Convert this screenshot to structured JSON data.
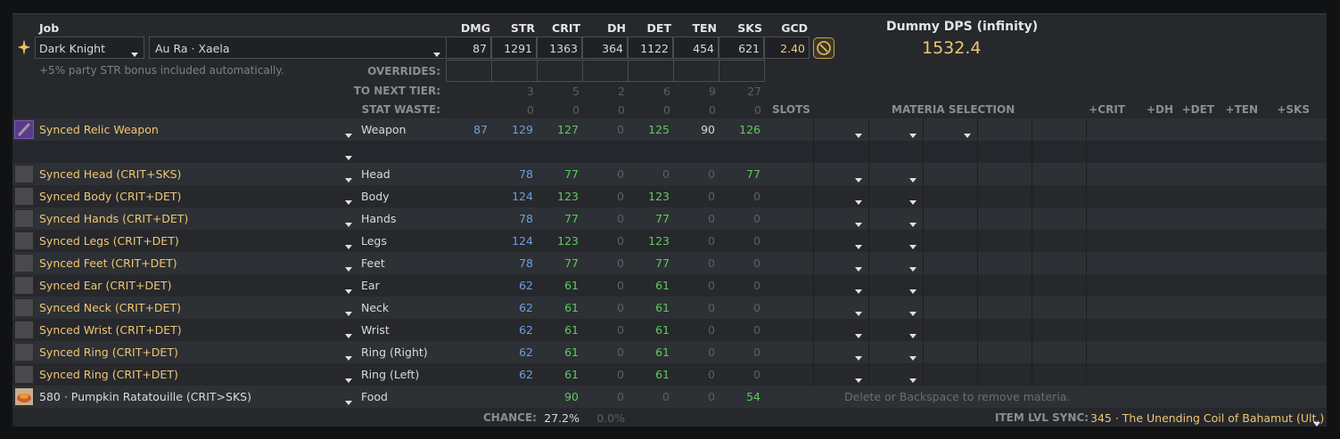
{
  "header": {
    "job_label": "Job",
    "stat_headers": [
      "DMG",
      "STR",
      "CRIT",
      "DH",
      "DET",
      "TEN",
      "SKS",
      "GCD"
    ],
    "job_value": "Dark Knight",
    "race_value": "Au Ra · Xaela",
    "stat_values": [
      "87",
      "1291",
      "1363",
      "364",
      "1122",
      "454",
      "621",
      "2.40"
    ],
    "party_bonus_note": "+5% party STR bonus included automatically.",
    "overrides_label": "OVERRIDES:",
    "to_next_tier_label": "TO NEXT TIER:",
    "to_next_tier_values": [
      "3",
      "5",
      "2",
      "6",
      "9",
      "27"
    ],
    "stat_waste_label": "STAT WASTE:",
    "stat_waste_values": [
      "0",
      "0",
      "0",
      "0",
      "0",
      "0"
    ]
  },
  "dps": {
    "title": "Dummy DPS (infinity)",
    "value": "1532.4"
  },
  "columns": {
    "slots": "SLOTS",
    "materia_selection": "MATERIA SELECTION",
    "plus_headers": [
      "+CRIT",
      "+DH",
      "+DET",
      "+TEN",
      "+SKS"
    ]
  },
  "gear": [
    {
      "name": "Synced Relic Weapon",
      "slot": "Weapon",
      "dmg": "87",
      "str": "129",
      "crit": "127",
      "dh": "0",
      "det": "125",
      "ten": "90",
      "sks": "126",
      "icon": "sword-icon"
    },
    {
      "name": "Synced Head (CRIT+SKS)",
      "slot": "Head",
      "dmg": "",
      "str": "78",
      "crit": "77",
      "dh": "0",
      "det": "0",
      "ten": "0",
      "sks": "77",
      "icon": "head-icon"
    },
    {
      "name": "Synced Body (CRIT+DET)",
      "slot": "Body",
      "dmg": "",
      "str": "124",
      "crit": "123",
      "dh": "0",
      "det": "123",
      "ten": "0",
      "sks": "0",
      "icon": "body-icon"
    },
    {
      "name": "Synced Hands (CRIT+DET)",
      "slot": "Hands",
      "dmg": "",
      "str": "78",
      "crit": "77",
      "dh": "0",
      "det": "77",
      "ten": "0",
      "sks": "0",
      "icon": "hands-icon"
    },
    {
      "name": "Synced Legs (CRIT+DET)",
      "slot": "Legs",
      "dmg": "",
      "str": "124",
      "crit": "123",
      "dh": "0",
      "det": "123",
      "ten": "0",
      "sks": "0",
      "icon": "legs-icon"
    },
    {
      "name": "Synced Feet (CRIT+DET)",
      "slot": "Feet",
      "dmg": "",
      "str": "78",
      "crit": "77",
      "dh": "0",
      "det": "77",
      "ten": "0",
      "sks": "0",
      "icon": "feet-icon"
    },
    {
      "name": "Synced Ear (CRIT+DET)",
      "slot": "Ear",
      "dmg": "",
      "str": "62",
      "crit": "61",
      "dh": "0",
      "det": "61",
      "ten": "0",
      "sks": "0",
      "icon": "ear-icon"
    },
    {
      "name": "Synced Neck (CRIT+DET)",
      "slot": "Neck",
      "dmg": "",
      "str": "62",
      "crit": "61",
      "dh": "0",
      "det": "61",
      "ten": "0",
      "sks": "0",
      "icon": "neck-icon"
    },
    {
      "name": "Synced Wrist (CRIT+DET)",
      "slot": "Wrist",
      "dmg": "",
      "str": "62",
      "crit": "61",
      "dh": "0",
      "det": "61",
      "ten": "0",
      "sks": "0",
      "icon": "wrist-icon"
    },
    {
      "name": "Synced Ring (CRIT+DET)",
      "slot": "Ring (Right)",
      "dmg": "",
      "str": "62",
      "crit": "61",
      "dh": "0",
      "det": "61",
      "ten": "0",
      "sks": "0",
      "icon": "ring-icon"
    },
    {
      "name": "Synced Ring (CRIT+DET)",
      "slot": "Ring (Left)",
      "dmg": "",
      "str": "62",
      "crit": "61",
      "dh": "0",
      "det": "61",
      "ten": "0",
      "sks": "0",
      "icon": "ring-icon"
    }
  ],
  "food": {
    "name": "580 · Pumpkin Ratatouille (CRIT>SKS)",
    "slot": "Food",
    "crit": "90",
    "dh": "0",
    "det": "0",
    "ten": "0",
    "sks": "54",
    "hint": "Delete or Backspace to remove materia."
  },
  "footer": {
    "chance_label": "CHANCE:",
    "chance_crit": "27.2%",
    "chance_dh": "0.0%",
    "sync_label": "ITEM LVL SYNC:",
    "sync_value": "345 · The Unending Coil of Bahamut (Ult.)"
  },
  "colors": {
    "accent_gold": "#f0c674",
    "stat_blue": "#6f9ee0",
    "stat_green": "#5ecb5e"
  }
}
